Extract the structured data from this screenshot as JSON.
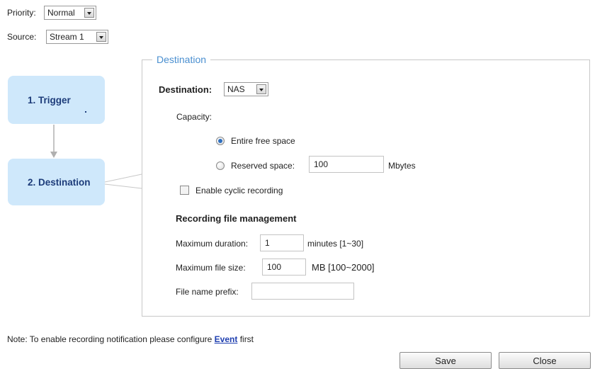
{
  "priority": {
    "label": "Priority:",
    "value": "Normal"
  },
  "source": {
    "label": "Source:",
    "value": "Stream 1"
  },
  "steps": [
    {
      "label": "1. Trigger"
    },
    {
      "label": "2. Destination"
    }
  ],
  "destination_panel": {
    "legend": "Destination",
    "dest_label": "Destination:",
    "dest_value": "NAS",
    "capacity_label": "Capacity:",
    "entire_free_space_label": "Entire free space",
    "reserved_space_label": "Reserved space:",
    "reserved_space_value": "100",
    "reserved_space_unit": "Mbytes",
    "cyclic_label": "Enable cyclic recording",
    "rfm_heading": "Recording file management",
    "max_duration_label": "Maximum duration:",
    "max_duration_value": "1",
    "max_duration_unit": "minutes [1~30]",
    "max_file_size_label": "Maximum file size:",
    "max_file_size_value": "100",
    "max_file_size_unit": "MB [100~2000]",
    "file_prefix_label": "File name prefix:",
    "file_prefix_value": ""
  },
  "note": {
    "prefix": "Note: To enable recording notification please configure",
    "link": "Event",
    "suffix": "first"
  },
  "buttons": {
    "save": "Save",
    "close": "Close"
  }
}
